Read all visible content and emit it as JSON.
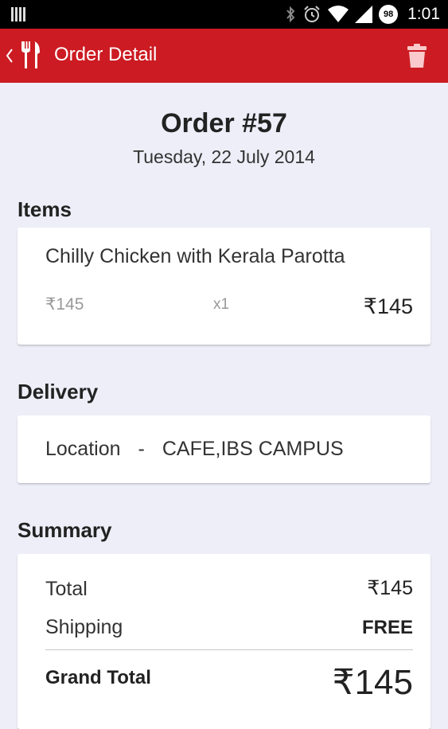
{
  "status_bar": {
    "time": "1:01",
    "battery": "98"
  },
  "app_bar": {
    "title": "Order Detail"
  },
  "order": {
    "title": "Order #57",
    "date": "Tuesday, 22 July 2014"
  },
  "items": {
    "heading": "Items",
    "list": [
      {
        "name": "Chilly Chicken with Kerala Parotta",
        "unit_price": "₹145",
        "quantity": "x1",
        "total": "₹145"
      }
    ]
  },
  "delivery": {
    "heading": "Delivery",
    "label": "Location",
    "separator": "-",
    "value": "CAFE,IBS CAMPUS"
  },
  "summary": {
    "heading": "Summary",
    "total_label": "Total",
    "total_value": "₹145",
    "shipping_label": "Shipping",
    "shipping_value": "FREE",
    "grand_total_label": "Grand Total",
    "grand_total_value": "₹145"
  },
  "colors": {
    "app_bar": "#cc1b22",
    "background": "#edeef8",
    "card": "#ffffff"
  },
  "icons": {
    "notification": "notification-bars-icon",
    "bluetooth": "bluetooth-icon",
    "alarm": "alarm-icon",
    "wifi": "wifi-icon",
    "signal": "signal-icon",
    "battery": "battery-icon",
    "back": "chevron-left-icon",
    "app": "fork-knife-icon",
    "delete": "trash-icon"
  }
}
